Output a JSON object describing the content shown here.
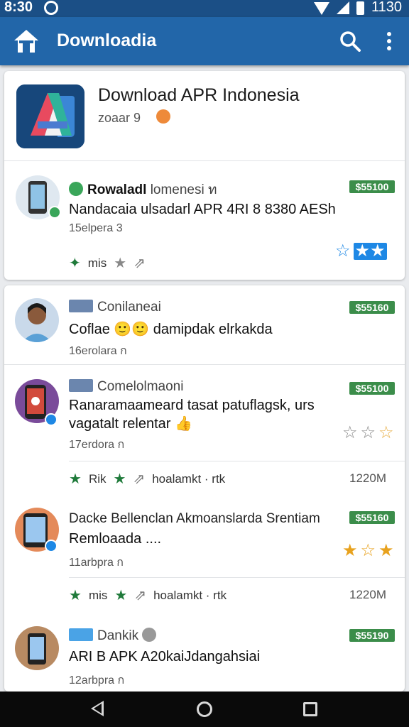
{
  "status": {
    "time": "8:30",
    "battery": "1130"
  },
  "appbar": {
    "title": "Downloadia",
    "home_icon": "home-icon",
    "search_icon": "search-icon",
    "more_icon": "more-vert-icon"
  },
  "app": {
    "title": "Download APR Indonesia",
    "subtitle": "zoaar 9"
  },
  "featured": {
    "author": "Rowaladl",
    "author_suffix": "lomenesi ท",
    "price": "$55100",
    "headline": "Nandacaia ulsadarl APR 4RI 8 8380 AESh",
    "meta": "15elpera 3",
    "action_label": "mis",
    "rating_colors": {
      "outline": "#1e88e5",
      "fill": "#1e88e5"
    }
  },
  "items": [
    {
      "author": "Conilaneai",
      "price": "$55160",
      "headline": "Coflae 🙂🙂 damipdak elrkakda",
      "meta": "16erolara ก"
    },
    {
      "author": "Comelolmaoni",
      "price": "$55100",
      "headline1": "Ranaramaameard tasat patuflagsk, urs",
      "headline2": "vagatalt relentar 👍",
      "meta": "17erdora ก",
      "action_label": "Rik",
      "action_text": "hoalamkt · rtk",
      "size": "1220M"
    },
    {
      "author": "Dacke Bellenclan Akmoanslarda Srentiam",
      "price": "$55160",
      "headline": "Remloaada ....",
      "meta": "11arbpra ก",
      "action_label": "mis",
      "action_text": "hoalamkt · rtk",
      "size": "1220M"
    },
    {
      "author": "Dankik",
      "price": "$55190",
      "headline": "ARI B APK A20kaiJdangahsiai",
      "meta": "12arbpra ก"
    }
  ]
}
